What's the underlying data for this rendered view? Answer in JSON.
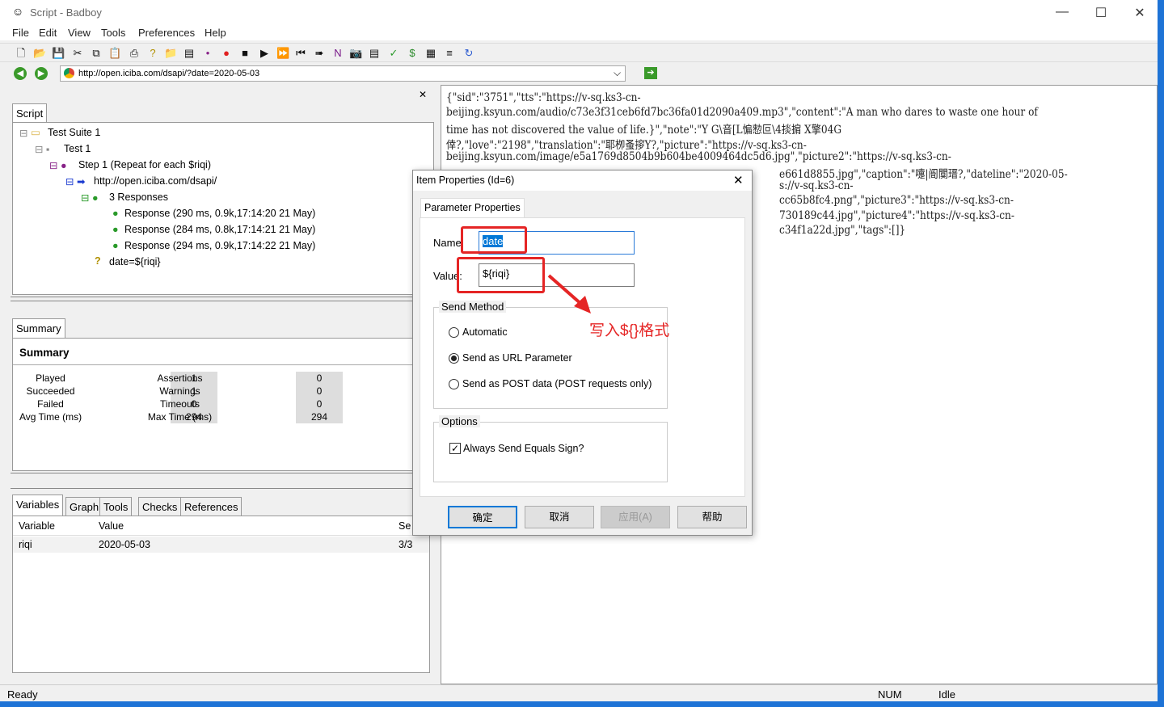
{
  "window": {
    "title": "Script - Badboy",
    "minimize": "—",
    "maximize": "☐",
    "close": "✕"
  },
  "menu": [
    "File",
    "Edit",
    "View",
    "Tools",
    "Preferences",
    "Help"
  ],
  "toolbar": {
    "icons": [
      "new-icon",
      "open-icon",
      "save-icon",
      "cut-icon",
      "copy-icon",
      "paste-icon",
      "print-icon",
      "help-icon",
      "add-folder-icon",
      "add-step-icon",
      "add-item-icon",
      "record-icon",
      "stop-icon",
      "play-icon",
      "play-all-icon",
      "rewind-icon",
      "step-icon",
      "n-icon",
      "camera-icon",
      "report-icon",
      "check-icon",
      "dollar-icon",
      "table-icon",
      "chart-icon",
      "refresh-icon"
    ]
  },
  "address": {
    "url": "http://open.iciba.com/dsapi/?date=2020-05-03"
  },
  "script_panel": {
    "tab": "Script",
    "tree": [
      "Test Suite 1",
      "Test 1",
      "Step 1 (Repeat for each $riqi)",
      "http://open.iciba.com/dsapi/",
      "3 Responses",
      "Response (290 ms, 0.9k,17:14:20 21 May)",
      "Response (284 ms, 0.8k,17:14:21 21 May)",
      "Response (294 ms, 0.9k,17:14:22 21 May)",
      "date=${riqi}"
    ]
  },
  "summary": {
    "tab": "Summary",
    "heading": "Summary",
    "rows": [
      {
        "l1": "Played",
        "v1": "1",
        "l2": "Assertions",
        "v2": "0"
      },
      {
        "l1": "Succeeded",
        "v1": "1",
        "l2": "Warnings",
        "v2": "0"
      },
      {
        "l1": "Failed",
        "v1": "0",
        "l2": "Timeouts",
        "v2": "0"
      },
      {
        "l1": "Avg Time (ms)",
        "v1": "294",
        "l2": "Max Time (ms)",
        "v2": "294"
      }
    ]
  },
  "variables": {
    "tabs": [
      "Variables",
      "Graph",
      "Tools",
      "Checks",
      "References"
    ],
    "columns": [
      "Variable",
      "Value",
      "Se"
    ],
    "rows": [
      {
        "variable": "riqi",
        "value": "2020-05-03",
        "seq": "3/3"
      }
    ]
  },
  "response_text": [
    "{\"sid\":\"3751\",\"tts\":\"https://v-sq.ks3-cn-",
    "beijing.ksyun.com/audio/c73e3f31ceb6fd7bc36fa01d2090a409.mp3\",\"content\":\"A man who dares to waste one hour of",
    "time has not discovered the value of life.}\",\"note\":\"Y G\\音[L惼愸叵\\4掞掮  X擎04G",
    "倖?,\"love\":\"2198\",\"translation\":\"耶栁蚤摉Y?,\"picture\":\"https://v-sq.ks3-cn-",
    "beijing.ksyun.com/image/e5a1769d8504b9b604be4009464dc5d6.jpg\",\"picture2\":\"https://v-sq.ks3-cn-",
    "e661d8855.jpg\",\"caption\":\"嚏|阍闃瑨?,\"dateline\":\"2020-05-",
    "s://v-sq.ks3-cn-",
    "cc65b8fc4.png\",\"picture3\":\"https://v-sq.ks3-cn-",
    "730189c44.jpg\",\"picture4\":\"https://v-sq.ks3-cn-",
    "c34f1a22d.jpg\",\"tags\":[]}"
  ],
  "dialog": {
    "title": "Item Properties (Id=6)",
    "tab": "Parameter Properties",
    "name_label": "Name",
    "name_value": "date",
    "value_label": "Value:",
    "value_value": "${riqi}",
    "send_method": "Send Method",
    "options_radio": [
      "Automatic",
      "Send as URL Parameter",
      "Send as POST data (POST requests only)"
    ],
    "selected_radio": 1,
    "options_group": "Options",
    "checkbox": "Always Send Equals Sign?",
    "checkbox_checked": true,
    "buttons": [
      "确定",
      "取消",
      "应用(A)",
      "帮助"
    ]
  },
  "annotation": {
    "text": "写入${}格式",
    "color": "#e52525"
  },
  "status": {
    "left": "Ready",
    "num": "NUM",
    "state": "Idle"
  }
}
